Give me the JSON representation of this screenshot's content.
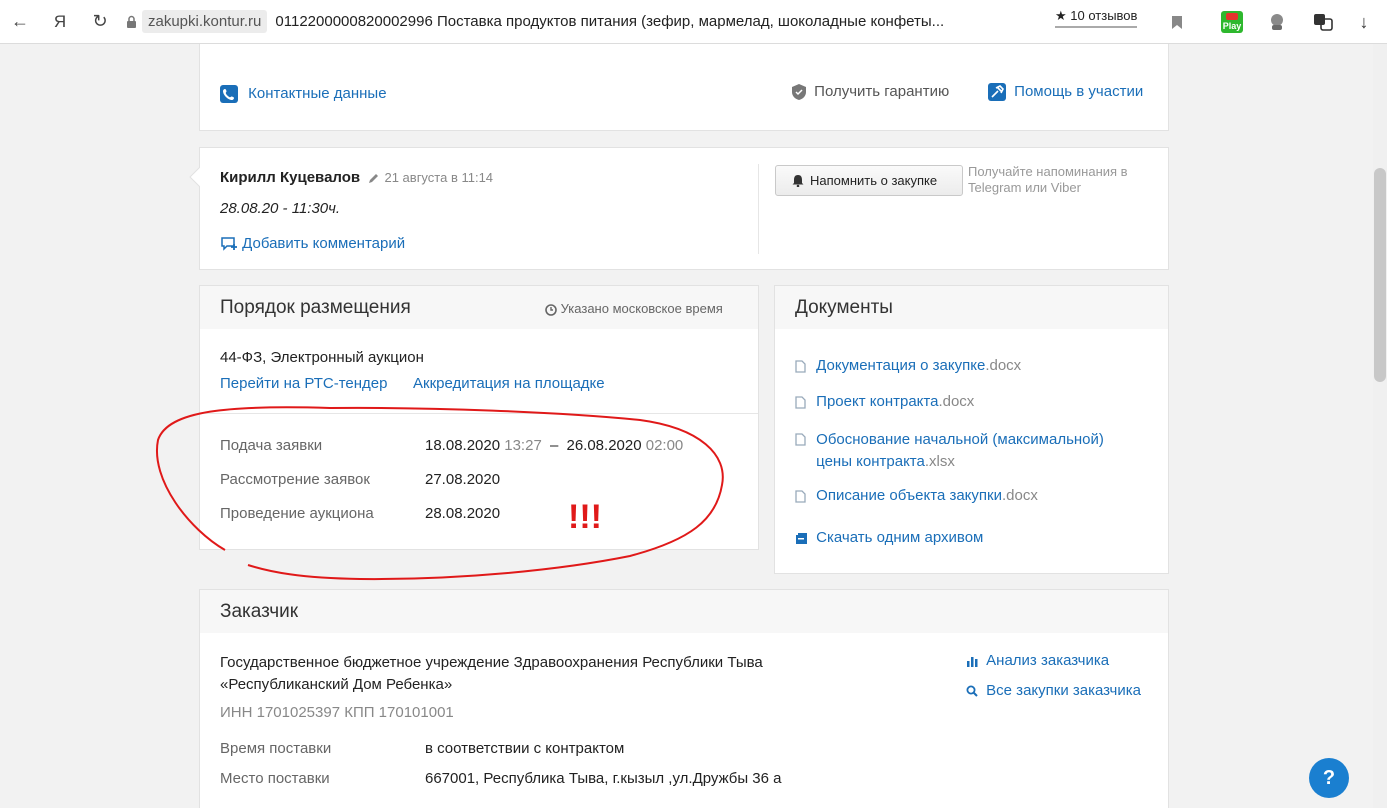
{
  "browser": {
    "back_glyph": "←",
    "ya_glyph": "Я",
    "reload_glyph": "↻",
    "domain": "zakupki.kontur.ru",
    "title": "0112200000820002996 Поставка продуктов питания (зефир, мармелад, шоколадные конфеты...",
    "reviews_label": "★ 10 отзывов",
    "play_label": "Play",
    "download_glyph": "↓"
  },
  "top_card": {
    "contacts_label": "Контактные данные",
    "guarantee_label": "Получить гарантию",
    "help_label": "Помощь в участии"
  },
  "comment": {
    "author": "Кирилл Куцевалов",
    "date": "21 августа в 11:14",
    "text": "28.08.20 - 11:30ч.",
    "add_label": "Добавить комментарий",
    "more_glyph": "⋮",
    "remind_button": "Напомнить о закупке",
    "remind_hint_1": "Получайте напоминания в",
    "remind_hint_2": "Telegram или Viber"
  },
  "placement": {
    "title": "Порядок размещения",
    "time_note": "Указано московское время",
    "law": "44-ФЗ, Электронный аукцион",
    "link_rts": "Перейти на РТС-тендер",
    "link_accreditation": "Аккредитация на площадке",
    "rows": [
      {
        "label": "Подача заявки",
        "date1": "18.08.2020",
        "time1": "13:27",
        "sep": "–",
        "date2": "26.08.2020",
        "time2": "02:00"
      },
      {
        "label": "Рассмотрение заявок",
        "date1": "27.08.2020"
      },
      {
        "label": "Проведение аукциона",
        "date1": "28.08.2020"
      }
    ]
  },
  "documents": {
    "title": "Документы",
    "items": [
      {
        "name": "Документация о закупке",
        "ext": ".docx"
      },
      {
        "name": "Проект контракта",
        "ext": ".docx"
      },
      {
        "name": "Обоснование начальной (максимальной)",
        "name2": "цены контракта",
        "ext": ".xlsx"
      },
      {
        "name": "Описание объекта закупки",
        "ext": ".docx"
      }
    ],
    "archive_label": "Скачать одним архивом"
  },
  "customer": {
    "title": "Заказчик",
    "name_line1": "Государственное бюджетное учреждение Здравоохранения Республики Тыва",
    "name_line2": "«Республиканский Дом Ребенка»",
    "inn": "ИНН 1701025397 КПП 170101001",
    "analysis_label": "Анализ заказчика",
    "all_purchases_label": "Все закупки заказчика",
    "delivery_time_label": "Время поставки",
    "delivery_time_value": "в соответствии с контрактом",
    "delivery_place_label": "Место поставки",
    "delivery_place_value": "667001, Республика Тыва, г.кызыл ,ул.Дружбы 36 а"
  },
  "annotation": {
    "marks": "!!!"
  },
  "help_button": "?",
  "colors": {
    "link": "#1a6eb8",
    "annotation": "#e01919",
    "help": "#1a7fd0"
  }
}
